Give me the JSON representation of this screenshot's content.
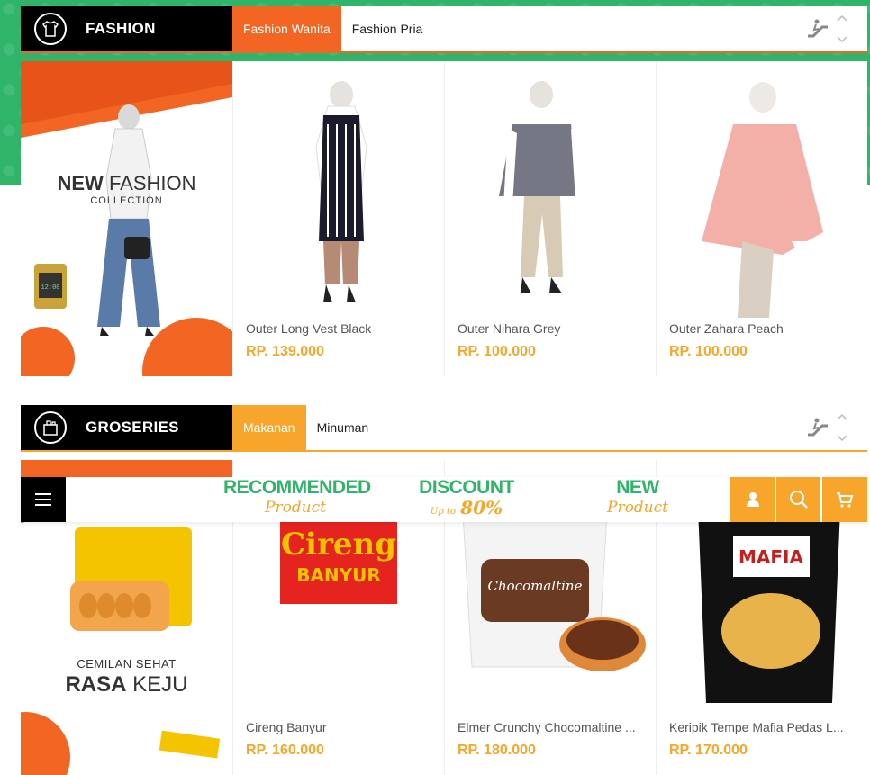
{
  "colors": {
    "accent_orange": "#f26522",
    "accent_yellow": "#f7a62b",
    "brand_green": "#2fb46a",
    "price": "#f7a62b"
  },
  "fashion": {
    "title": "FASHION",
    "icon": "tshirt-icon",
    "tabs": [
      {
        "label": "Fashion Wanita",
        "active": true
      },
      {
        "label": "Fashion Pria",
        "active": false
      }
    ],
    "banner": {
      "line1_bold": "NEW",
      "line1_rest": "FASHION",
      "line2": "COLLECTION"
    },
    "products": [
      {
        "name": "Outer Long Vest Black",
        "price": "RP. 139.000"
      },
      {
        "name": "Outer Nihara Grey",
        "price": "RP. 100.000"
      },
      {
        "name": "Outer Zahara Peach",
        "price": "RP. 100.000"
      }
    ]
  },
  "groceries": {
    "title": "GROSERIES",
    "icon": "grocery-bag-icon",
    "tabs": [
      {
        "label": "Makanan",
        "active": true
      },
      {
        "label": "Minuman",
        "active": false
      }
    ],
    "banner": {
      "line1": "CEMILAN SEHAT",
      "line2_bold": "RASA",
      "line2_rest": "KEJU"
    },
    "products": [
      {
        "name": "Cireng Banyur",
        "price": "RP. 160.000"
      },
      {
        "name": "Elmer Crunchy Chocomaltine ...",
        "price": "RP. 180.000"
      },
      {
        "name": "Keripik Tempe Mafia Pedas L...",
        "price": "RP. 170.000"
      }
    ]
  },
  "navbar": {
    "promos": [
      {
        "big": "RECOMMENDED",
        "small": "Product"
      },
      {
        "big": "DISCOUNT",
        "small_prefix": "Up to",
        "small": "80%"
      },
      {
        "big": "NEW",
        "small": "Product"
      }
    ],
    "buttons": [
      "user-icon",
      "search-icon",
      "cart-icon"
    ]
  }
}
